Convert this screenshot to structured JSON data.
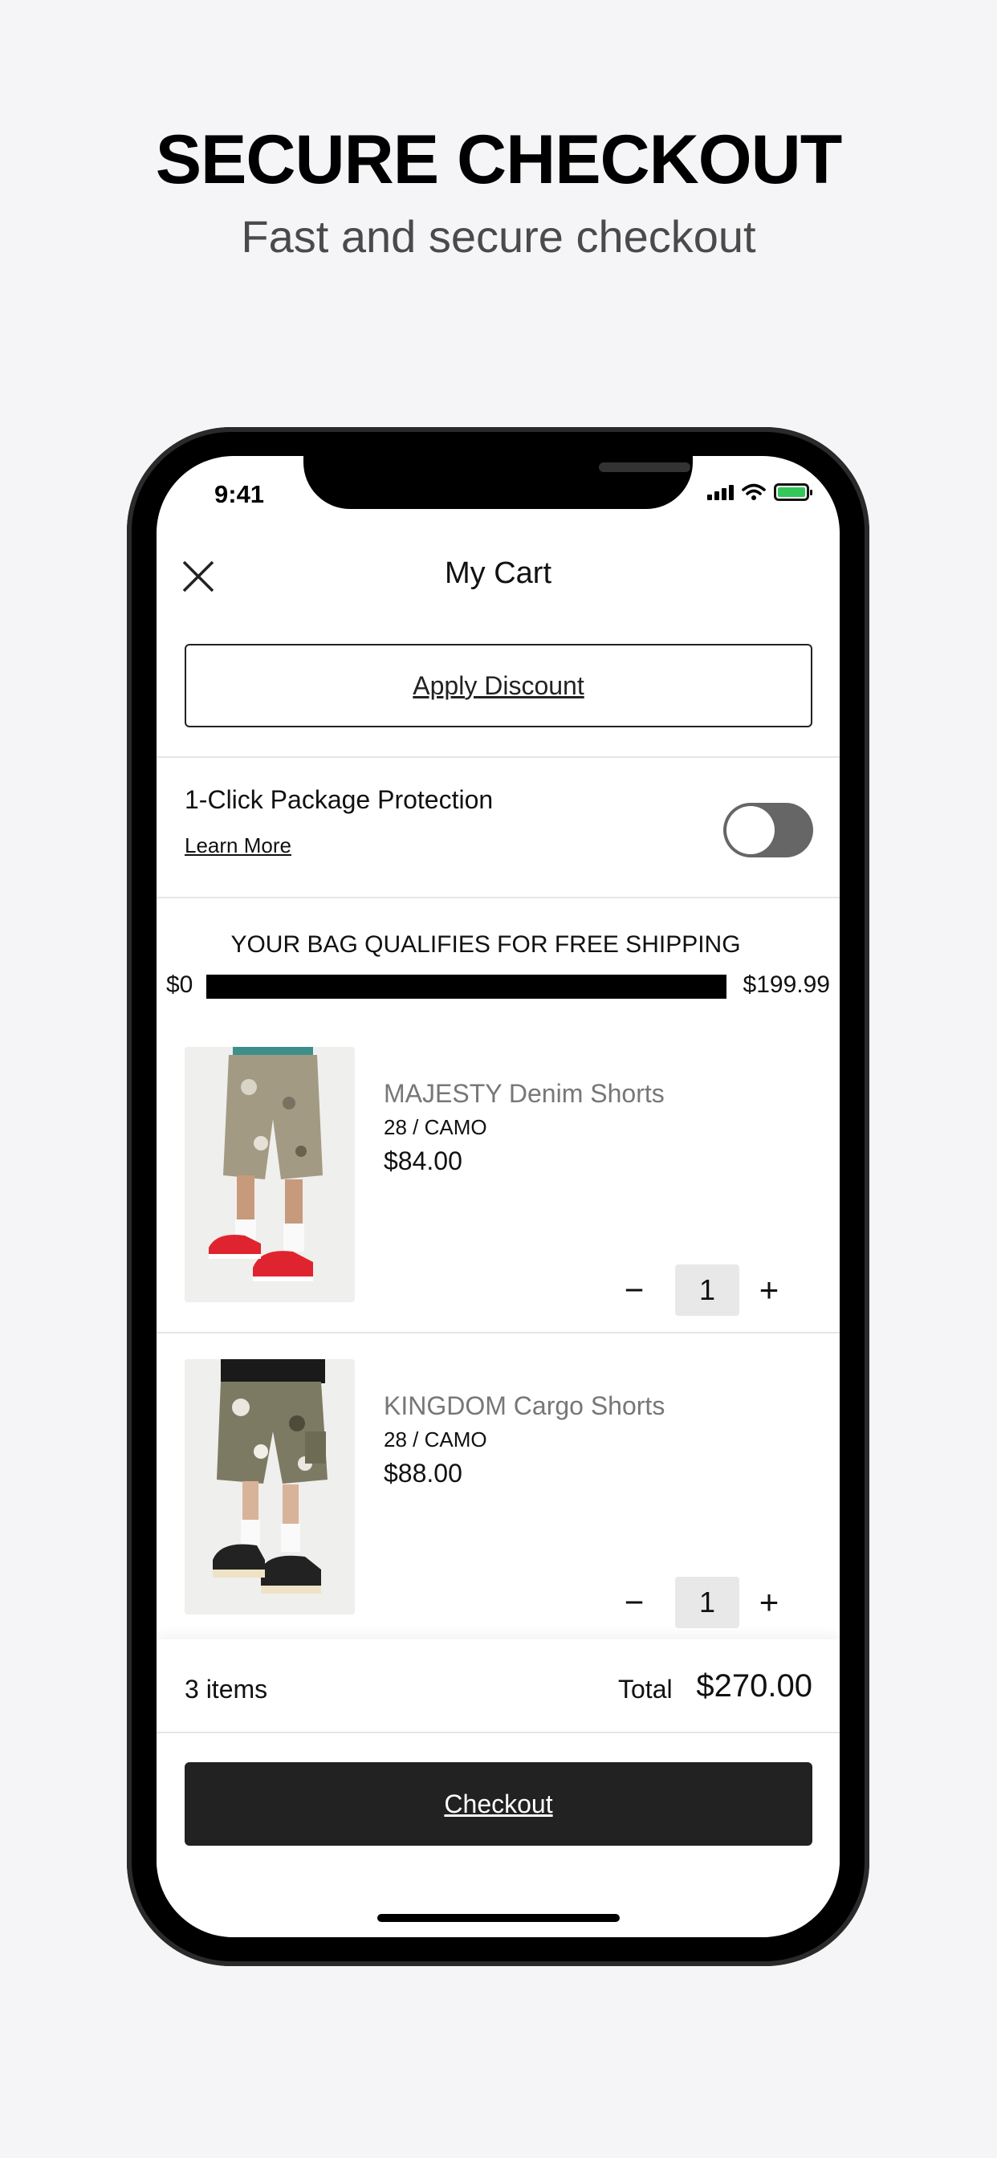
{
  "hero": {
    "title": "SECURE CHECKOUT",
    "subtitle": "Fast and secure checkout"
  },
  "status_bar": {
    "time": "9:41"
  },
  "header": {
    "title": "My Cart"
  },
  "discount": {
    "label": "Apply Discount"
  },
  "protection": {
    "title": "1-Click Package Protection",
    "link": "Learn More",
    "enabled": true
  },
  "shipping": {
    "title": "YOUR BAG QUALIFIES FOR FREE SHIPPING",
    "min_label": "$0",
    "max_label": "$199.99",
    "progress": 1.0
  },
  "items": [
    {
      "name": "MAJESTY Denim Shorts",
      "variant": "28 / CAMO",
      "price": "$84.00",
      "quantity": "1",
      "minus": "−",
      "plus": "+"
    },
    {
      "name": "KINGDOM Cargo Shorts",
      "variant": "28 / CAMO",
      "price": "$88.00",
      "quantity": "1",
      "minus": "−",
      "plus": "+"
    }
  ],
  "summary": {
    "items_count": "3 items",
    "total_label": "Total",
    "total": "$270.00"
  },
  "checkout": {
    "label": "Checkout"
  },
  "colors": {
    "background": "#f5f5f7",
    "primary_button": "#222222",
    "toggle": "#666666",
    "accent_red": "#e0242f",
    "battery": "#34c759"
  }
}
